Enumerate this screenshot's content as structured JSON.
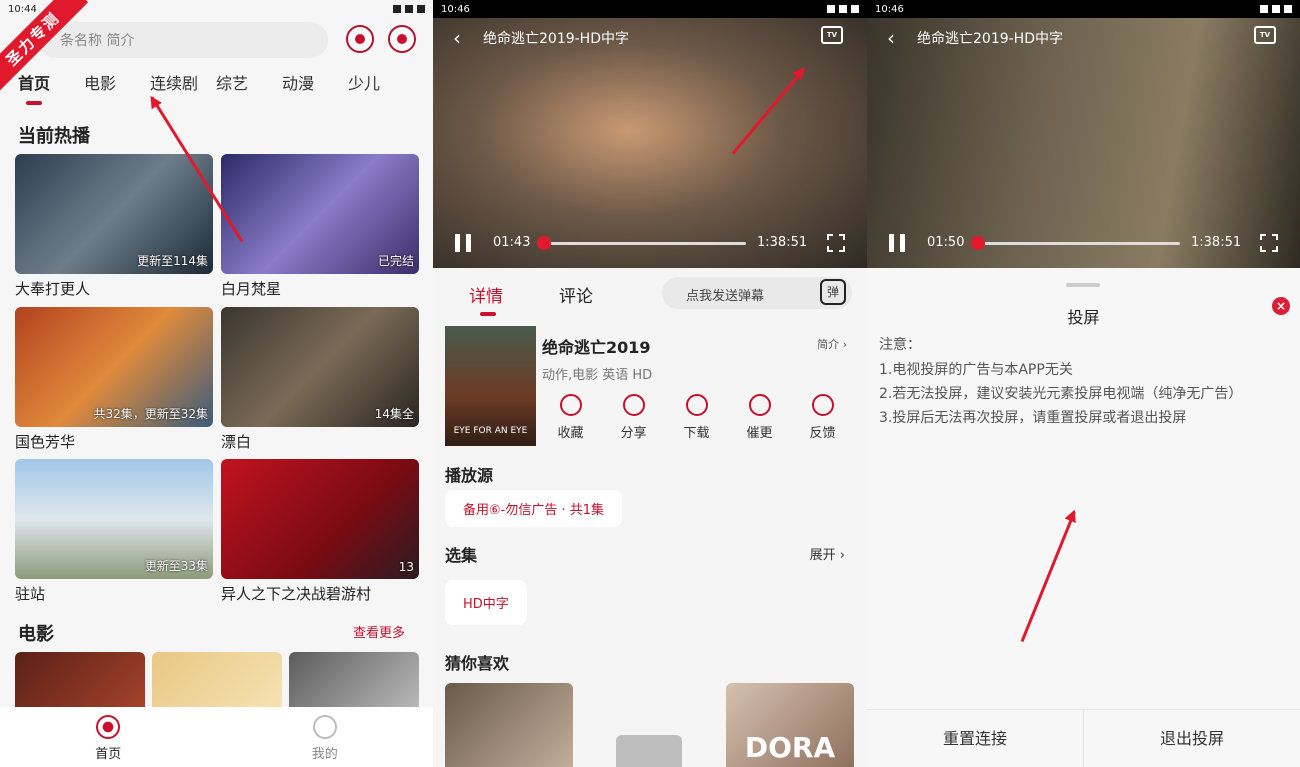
{
  "p1": {
    "time": "10:44",
    "ribbon": "圣力专测",
    "search_placeholder": "条名称 简介",
    "categories": [
      "首页",
      "电影",
      "连续剧",
      "综艺",
      "动漫",
      "少儿"
    ],
    "section_hot": "当前热播",
    "cards": [
      {
        "title": "大奉打更人",
        "badge": "更新至114集"
      },
      {
        "title": "白月梵星",
        "badge": "已完结"
      },
      {
        "title": "国色芳华",
        "badge": "共32集，更新至32集"
      },
      {
        "title": "漂白",
        "badge": "14集全"
      },
      {
        "title": "驻站",
        "badge": "更新至33集"
      },
      {
        "title": "异人之下之决战碧游村",
        "badge": "13"
      }
    ],
    "section_movie": "电影",
    "more": "查看更多",
    "nav": [
      "首页",
      "我的"
    ]
  },
  "p2": {
    "time": "10:46",
    "video_title": "绝命逃亡2019-HD中字",
    "tv_label": "TV",
    "cur": "01:43",
    "total": "1:38:51",
    "progress": 0.01,
    "tabs": [
      "详情",
      "评论"
    ],
    "danmu": "点我发送弹幕",
    "danmu_icon": "弹",
    "poster_text": "EYE FOR AN EYE",
    "movie_name": "绝命逃亡2019",
    "genre": "动作,电影 英语 HD",
    "intro": "简介",
    "actions": [
      "收藏",
      "分享",
      "下载",
      "催更",
      "反馈"
    ],
    "source_title": "播放源",
    "source_chip": "备用⑥-勿信广告 · 共1集",
    "episodes_title": "选集",
    "expand": "展开",
    "episode_chip": "HD中字",
    "guess_title": "猜你喜欢",
    "rec_text": "DORA"
  },
  "p3": {
    "time": "10:46",
    "video_title": "绝命逃亡2019-HD中字",
    "tv_label": "TV",
    "cur": "01:50",
    "total": "1:38:51",
    "progress": 0.02,
    "sheet_title": "投屏",
    "notes": [
      "注意：",
      "1.电视投屏的广告与本APP无关",
      "2.若无法投屏，建议安装光元素投屏电视端（纯净无广告）",
      "3.投屏后无法再次投屏，请重置投屏或者退出投屏"
    ],
    "reset": "重置连接",
    "exit": "退出投屏"
  },
  "colors": {
    "accent": "#c8102e",
    "ribbon": "#e0192d"
  }
}
